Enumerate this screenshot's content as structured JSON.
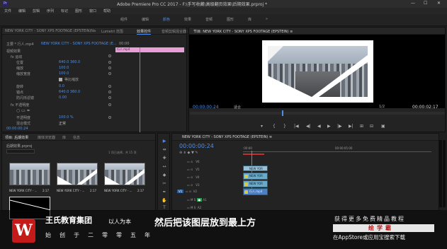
{
  "window": {
    "title": "Adobe Premiere Pro CC 2017 - F:\\手写收藏\\高级翻页效果\\后期效果.prproj *",
    "app_icon": "Pr",
    "minimize": "—",
    "maximize": "☐",
    "close": "✕"
  },
  "menu": [
    "文件",
    "编辑",
    "剪辑",
    "序列",
    "标记",
    "图形",
    "窗口",
    "帮助"
  ],
  "workspaces": [
    "组件",
    "编辑",
    "颜色",
    "效果",
    "音频",
    "图形",
    "库",
    "»"
  ],
  "effect_controls": {
    "tabs": [
      "NEW YORK CITY - SONY XPS FOOTAGE (EPSTEIN)Na",
      "Lumetri 范围",
      "效果控件",
      "音频剪辑混合器：N"
    ],
    "master_label": "主要 * 行人.mp4",
    "clip_label": "NEW YORK CITY - SONY XPS FOOTAGE (E...",
    "timecode_start": "00:00",
    "clip_bar_label": "行人.mp4",
    "rows": [
      {
        "label": "视频效果",
        "value": ""
      },
      {
        "label": "fx  运动",
        "value": ""
      },
      {
        "label": "位置",
        "value": "640.0   360.0"
      },
      {
        "label": "缩放",
        "value": "100.0"
      },
      {
        "label": "缩放宽度",
        "value": "100.0"
      },
      {
        "label": "等比缩放",
        "value": ""
      },
      {
        "label": "旋转",
        "value": "0.0"
      },
      {
        "label": "锚点",
        "value": "640.0   360.0"
      },
      {
        "label": "防闪烁滤镜",
        "value": "0.00"
      },
      {
        "label": "fx  不透明度",
        "value": ""
      },
      {
        "label": "不透明度",
        "value": "100.0 %"
      },
      {
        "label": "混合模式",
        "value": "正常"
      }
    ],
    "timecode": "00:00:00:24"
  },
  "program_monitor": {
    "tabs": [
      "节目: NEW YORK CITY - SONY XPS FOOTAGE (EPSTEIN) ≡"
    ],
    "timecode": "00:00:00:24",
    "fit": "适合",
    "fraction": "1/2",
    "duration": "00:00:02:17",
    "controls": [
      "▾",
      "{",
      "}",
      "|◀",
      "◀|",
      "◀",
      "▶",
      "|▶",
      "▶|",
      "⊞",
      "⊟",
      "▣"
    ]
  },
  "project": {
    "tabs": [
      "项目: 后期效果",
      "媒体浏览器",
      "库",
      "信息"
    ],
    "file": "后期效果.prproj",
    "count": "1 项已选择，共 15 项",
    "thumbnails": [
      {
        "label": "NEW YORK CITY - ...",
        "duration": "2:17"
      },
      {
        "label": "NEW YORK CITY - ...",
        "duration": "2:17"
      },
      {
        "label": "NEW YORK CITY - ...",
        "duration": "2:17"
      },
      {
        "label": "NEW YORK CITY - ...",
        "duration": ""
      }
    ]
  },
  "tools": [
    "▶",
    "⇹",
    "✚",
    "↔",
    "◆",
    "✂",
    "✒",
    "✋",
    "T"
  ],
  "timeline": {
    "tab": "NEW YORK CITY - SONY XPS FOOTAGE (EPSTEIN) ≡",
    "timecode": "00:00:00:24",
    "ruler_start": ":00:00",
    "ruler_mid": "00:00:05:00",
    "tracks": [
      {
        "name": "V6",
        "clip": ""
      },
      {
        "name": "V5",
        "clip": "NEW YOR"
      },
      {
        "name": "V4",
        "clip": "NEW YOR"
      },
      {
        "name": "V3",
        "clip": "NEW YOR"
      },
      {
        "name": "V2",
        "clip": "行人.mp4"
      },
      {
        "name": "V1",
        "clip": ""
      },
      {
        "name": "A1",
        "clip": ""
      },
      {
        "name": "A2",
        "clip": ""
      }
    ],
    "meter_db": [
      "0",
      "-12",
      "-24",
      "-36",
      "-48",
      "dB"
    ]
  },
  "overlay": {
    "logo_letter": "W",
    "org_name": "王氏教育集团",
    "motto": "以人为本",
    "verse": "始创于二零零五年",
    "subtitle": "然后把该图层放到最上方",
    "promo_line1": "获得更多免费精品教程",
    "promo_button": "绘学霸",
    "promo_line2": "在AppStore或应用宝搜索下载"
  },
  "colors": {
    "accent_blue": "#4b8ff0",
    "clip_blue": "#6aa9c8",
    "clip_pink": "#e89fd8",
    "logo_red": "#c41a1a"
  }
}
